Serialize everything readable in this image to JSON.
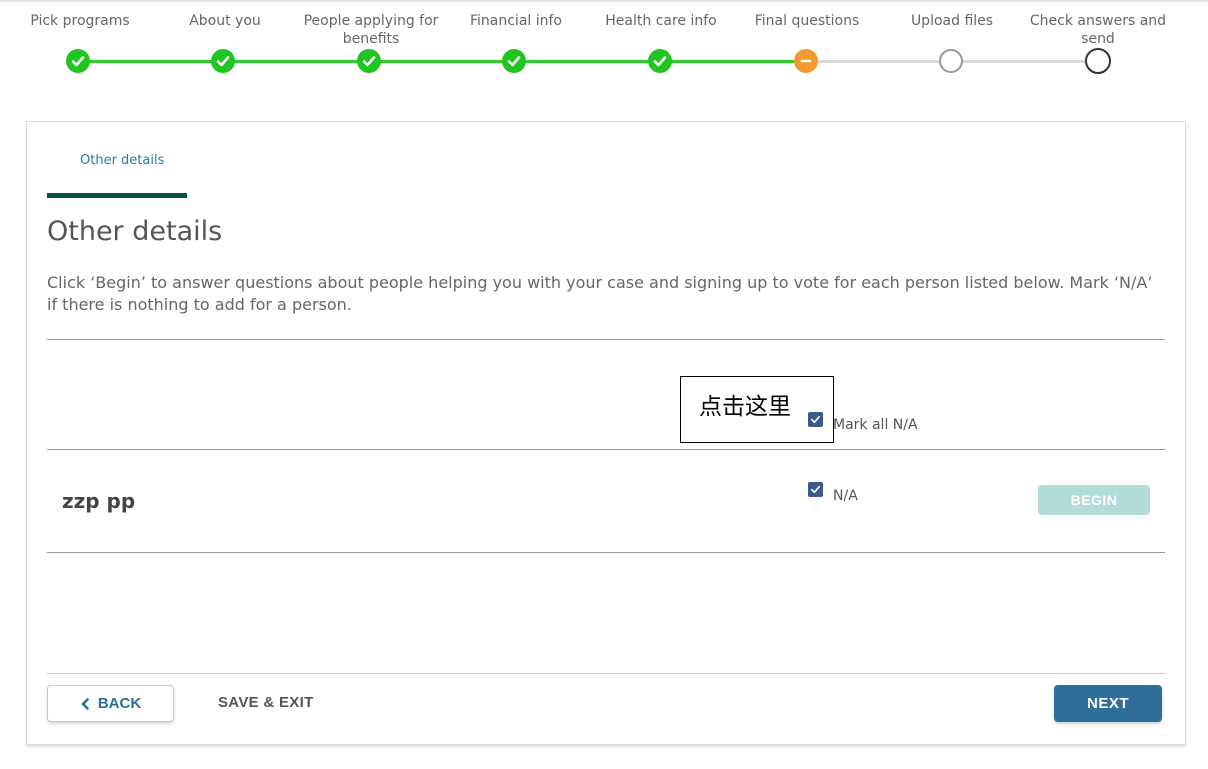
{
  "stepper": {
    "steps": [
      {
        "label": "Pick programs",
        "status": "done"
      },
      {
        "label": "About you",
        "status": "done"
      },
      {
        "label": "People applying for benefits",
        "status": "done"
      },
      {
        "label": "Financial info",
        "status": "done"
      },
      {
        "label": "Health care info",
        "status": "done"
      },
      {
        "label": "Final questions",
        "status": "current"
      },
      {
        "label": "Upload files",
        "status": "todo"
      },
      {
        "label": "Check answers and send",
        "status": "todo"
      }
    ],
    "colors": {
      "done": "#22c422",
      "current": "#f39a2e",
      "todo": "#999999"
    }
  },
  "section": {
    "tab_label": "Other details",
    "title": "Other details",
    "intro": "Click ‘Begin’ to answer questions about people helping you with your case and signing up to vote for each person listed below. Mark ‘N/A’ if there is nothing to add for a person."
  },
  "mark_all": {
    "label": "Mark all N/A",
    "checked": true
  },
  "annotation": {
    "text": "点击这里"
  },
  "people": [
    {
      "name": "zzp pp",
      "na_label": "N/A",
      "na_checked": true,
      "begin_label": "BEGIN"
    }
  ],
  "footer": {
    "back_label": "BACK",
    "save_exit_label": "SAVE & EXIT",
    "next_label": "NEXT"
  },
  "icons": {
    "check": "check-icon",
    "minus": "minus-icon",
    "back": "chevron-left-icon"
  },
  "theme": {
    "accent": "#2d6f98",
    "tab_underline": "#0b4f4a",
    "checkbox": "#3a5b8c",
    "begin_disabled": "#b3dbd7"
  }
}
